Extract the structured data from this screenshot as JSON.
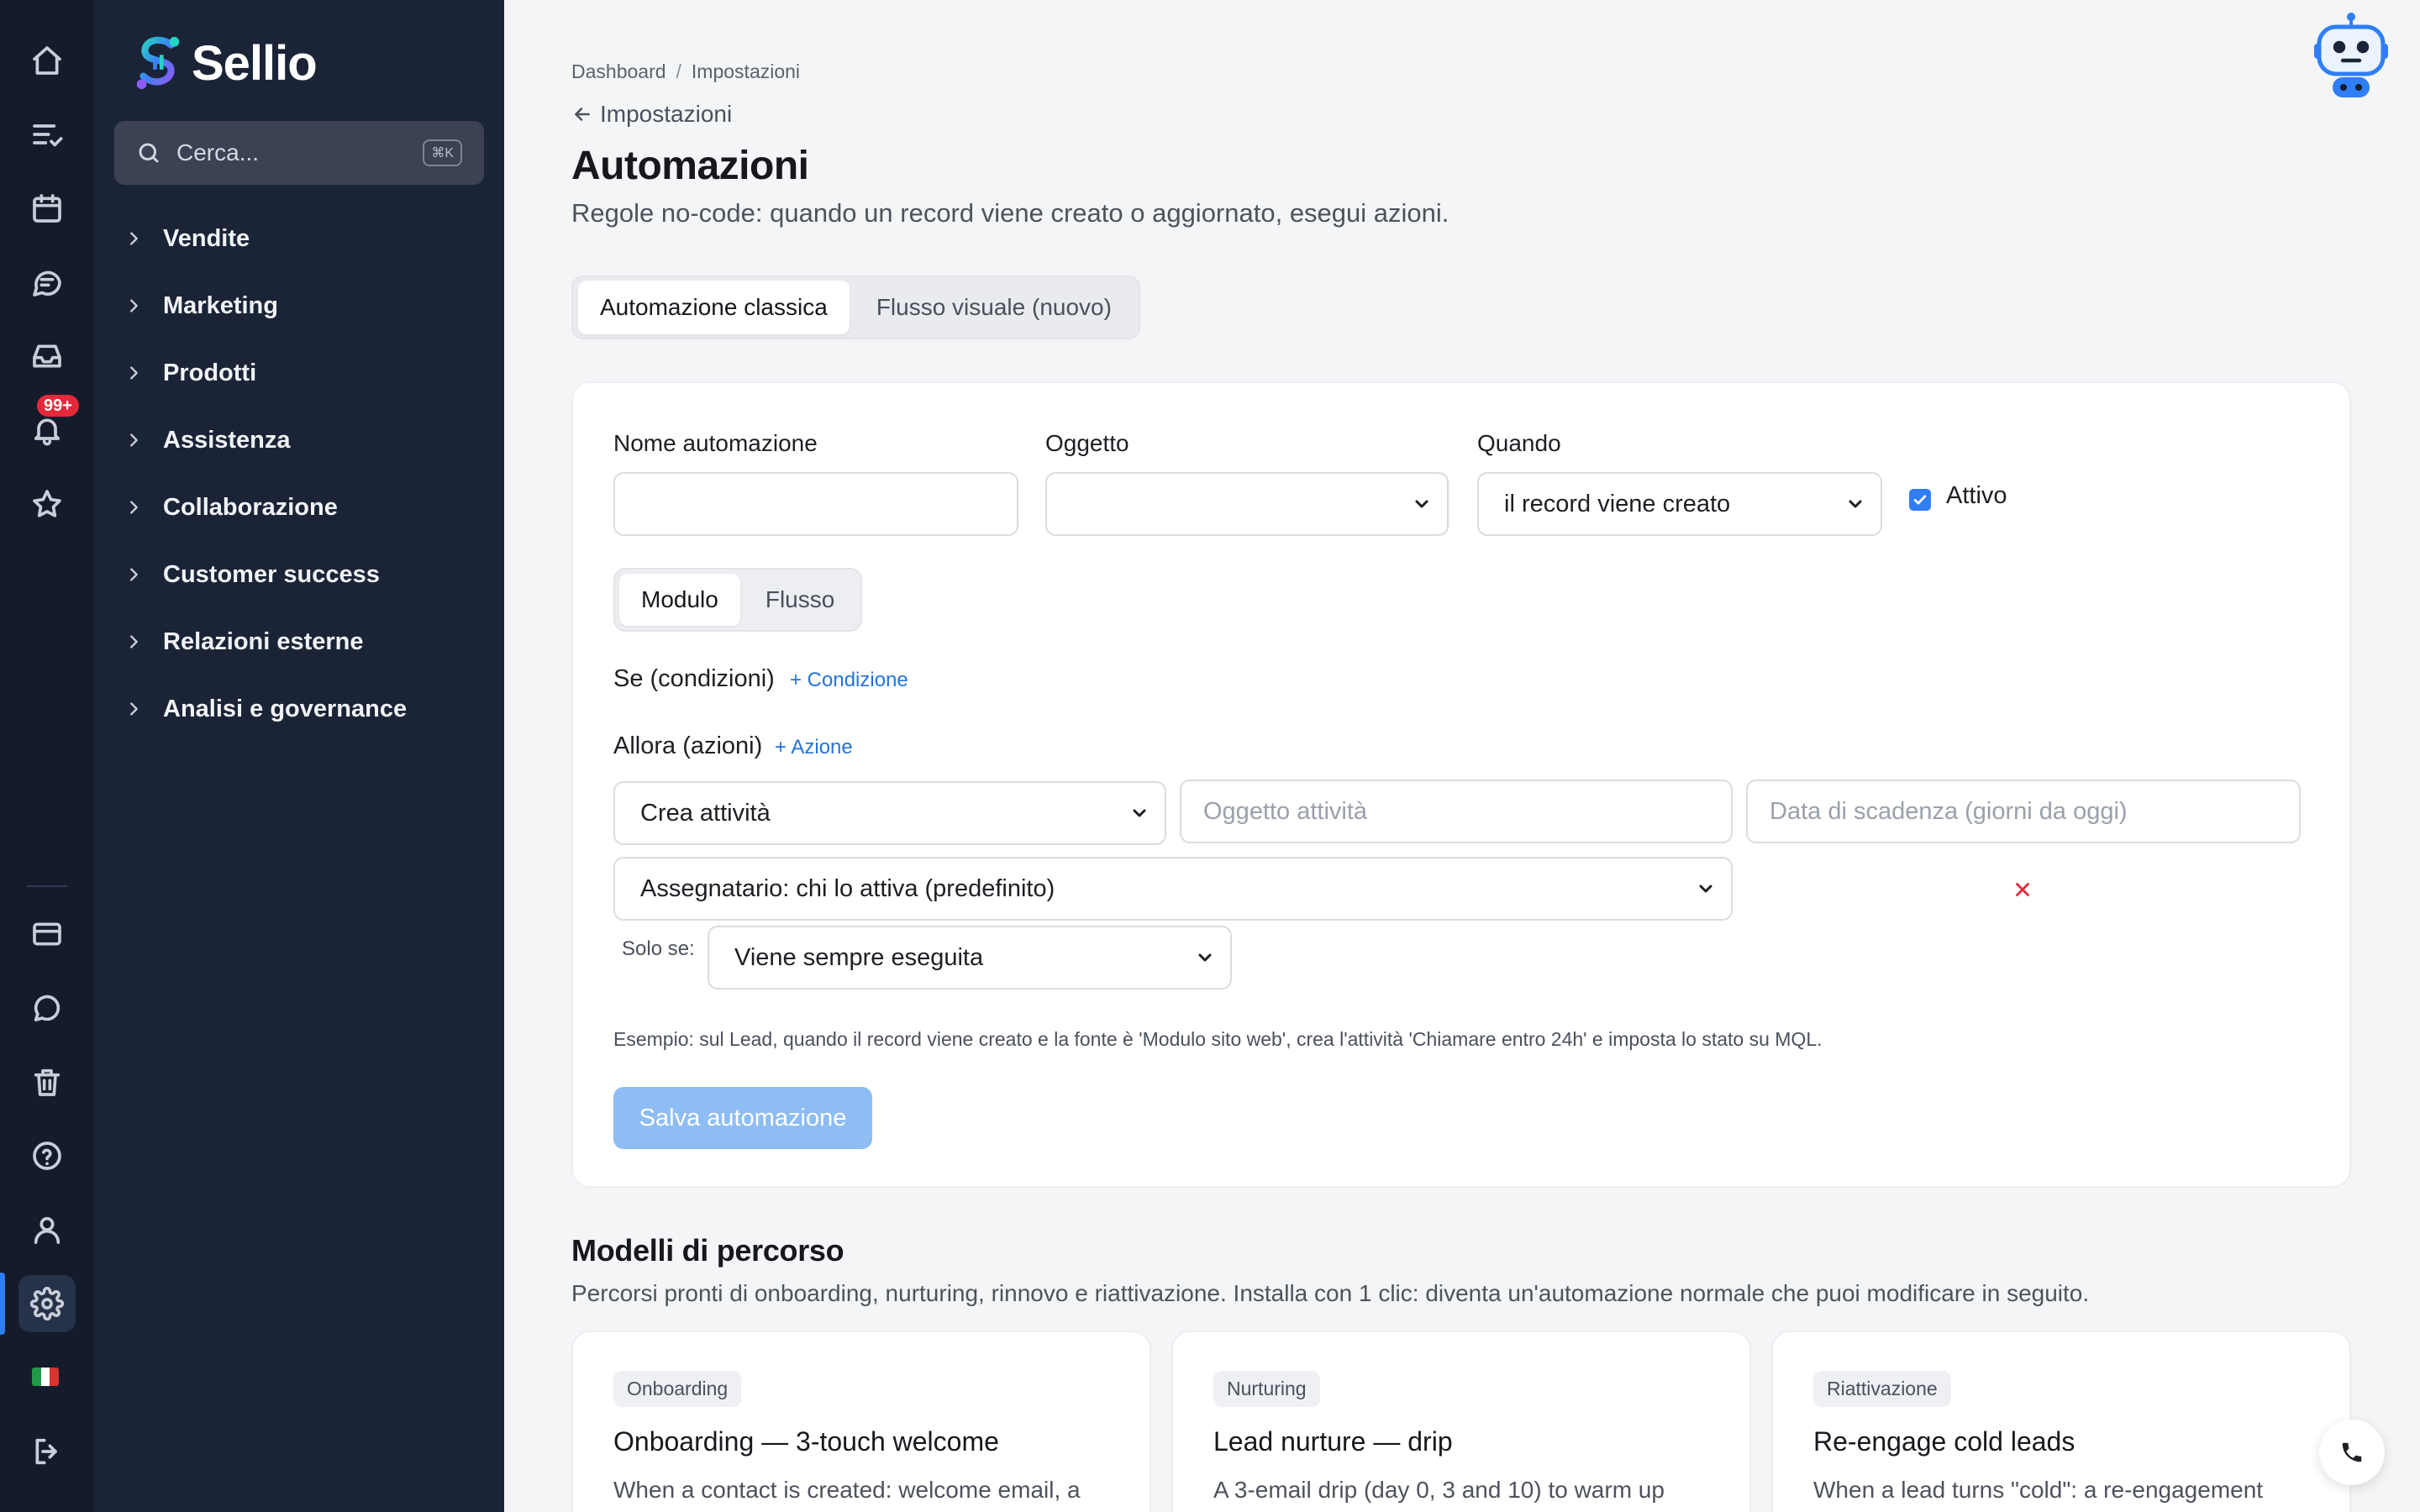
{
  "brand": {
    "name": "Sellio",
    "accent": "#2f7ef6",
    "rail_bg": "#141c2c",
    "nav_bg": "#1b2437"
  },
  "rail": {
    "top_items": [
      "home-icon",
      "tasks-icon",
      "calendar-icon",
      "chat-icon",
      "inbox-icon",
      "bell-icon",
      "star-icon"
    ],
    "bottom_items": [
      "billing-icon",
      "message-icon",
      "trash-icon",
      "help-icon",
      "user-icon",
      "settings-icon",
      "flag-icon",
      "logout-icon"
    ],
    "notification_badge": "99+"
  },
  "search": {
    "placeholder": "Cerca...",
    "shortcut": "⌘K"
  },
  "nav": {
    "items": [
      {
        "label": "Vendite"
      },
      {
        "label": "Marketing"
      },
      {
        "label": "Prodotti"
      },
      {
        "label": "Assistenza"
      },
      {
        "label": "Collaborazione"
      },
      {
        "label": "Customer success"
      },
      {
        "label": "Relazioni esterne"
      },
      {
        "label": "Analisi e governance"
      }
    ]
  },
  "breadcrumb": {
    "items": [
      "Dashboard",
      "Impostazioni"
    ]
  },
  "back_link": "Impostazioni",
  "page": {
    "title": "Automazioni",
    "subtitle": "Regole no-code: quando un record viene creato o aggiornato, esegui azioni."
  },
  "tabs": [
    {
      "label": "Automazione classica",
      "active": true
    },
    {
      "label": "Flusso visuale (nuovo)",
      "active": false
    }
  ],
  "form": {
    "name_label": "Nome automazione",
    "name_value": "",
    "object_label": "Oggetto",
    "object_value": "",
    "when_label": "Quando",
    "when_value": "il record viene creato",
    "active_label": "Attivo",
    "active_checked": true,
    "mode_tabs": [
      {
        "label": "Modulo",
        "active": true
      },
      {
        "label": "Flusso",
        "active": false
      }
    ],
    "conditions_label": "Se (condizioni)",
    "add_condition": "+ Condizione",
    "actions_label": "Allora (azioni)",
    "add_action": "+ Azione",
    "action": {
      "type_value": "Crea attività",
      "subject_placeholder": "Oggetto attività",
      "due_placeholder": "Data di scadenza (giorni da oggi)",
      "assignee_value": "Assegnatario: chi lo attiva (predefinito)",
      "only_if_label": "Solo se:",
      "only_if_value": "Viene sempre eseguita"
    },
    "example_text": "Esempio: sul Lead, quando il record viene creato e la fonte è 'Modulo sito web', crea l'attività 'Chiamare entro 24h' e imposta lo stato su MQL.",
    "save_label": "Salva automazione"
  },
  "templates": {
    "title": "Modelli di percorso",
    "subtitle": "Percorsi pronti di onboarding, nurturing, rinnovo e riattivazione. Installa con 1 clic: diventa un'automazione normale che puoi modificare in seguito.",
    "cards": [
      {
        "tag": "Onboarding",
        "title": "Onboarding — 3-touch welcome",
        "desc": "When a contact is created: welcome email, a"
      },
      {
        "tag": "Nurturing",
        "title": "Lead nurture — drip",
        "desc": "A 3-email drip (day 0, 3 and 10) to warm up"
      },
      {
        "tag": "Riattivazione",
        "title": "Re-engage cold leads",
        "desc": "When a lead turns \"cold\": a re-engagement"
      }
    ]
  }
}
